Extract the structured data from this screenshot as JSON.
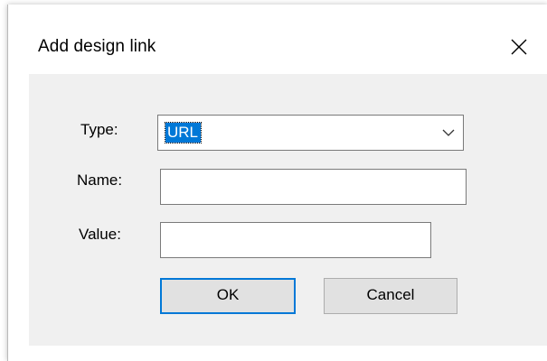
{
  "dialog": {
    "title": "Add design link",
    "close_icon": "close-icon"
  },
  "form": {
    "type_label": "Type:",
    "type_value": "URL",
    "type_dropdown_icon": "chevron-down-icon",
    "name_label": "Name:",
    "name_value": "",
    "value_label": "Value:",
    "value_value": ""
  },
  "buttons": {
    "ok_label": "OK",
    "cancel_label": "Cancel"
  },
  "colors": {
    "selection": "#0078d7",
    "panel_bg": "#f0f0f0",
    "button_bg": "#e1e1e1"
  }
}
